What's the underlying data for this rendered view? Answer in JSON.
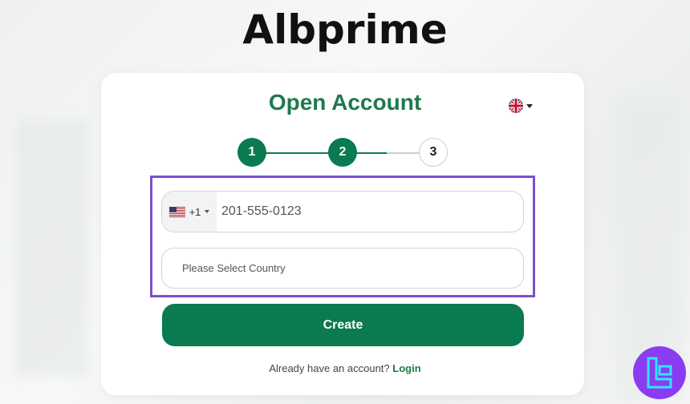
{
  "brand": {
    "logo_text": "Albprime"
  },
  "form": {
    "title": "Open Account",
    "steps": [
      "1",
      "2",
      "3"
    ],
    "current_step": 2,
    "phone": {
      "country_code": "+1",
      "flag": "us-flag-icon",
      "value": "201-555-0123"
    },
    "country": {
      "placeholder": "Please Select Country"
    },
    "submit_label": "Create",
    "login_prompt": "Already have an account?",
    "login_link": "Login"
  },
  "language": {
    "flag": "uk-flag-icon"
  },
  "colors": {
    "accent": "#0a7a50",
    "title": "#1e7a4c",
    "highlight": "#7b4fcf",
    "badge": "#8a3cf0"
  }
}
